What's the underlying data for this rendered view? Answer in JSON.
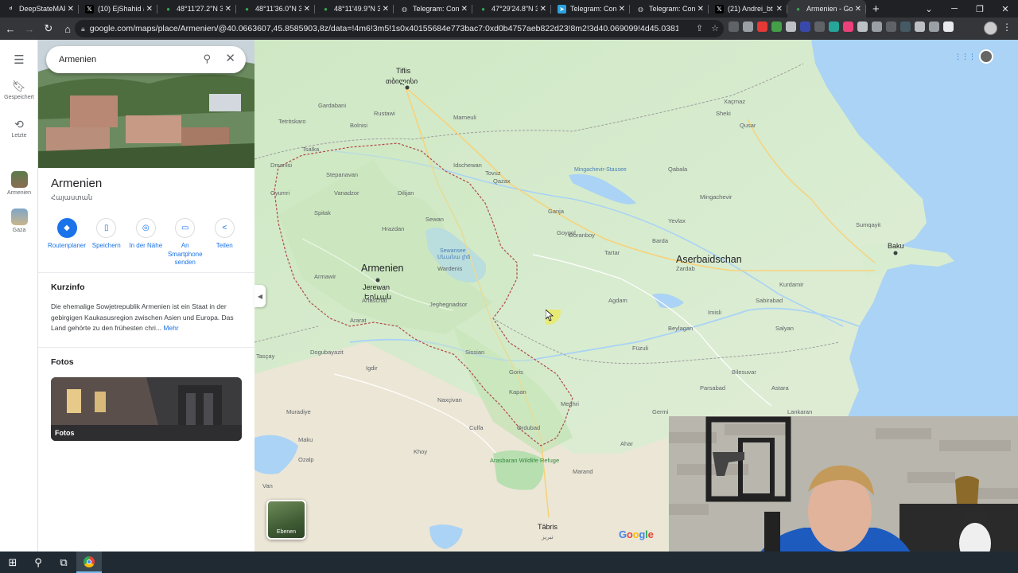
{
  "browser": {
    "tabs": [
      {
        "title": "DeepStateMAP",
        "favicon": "deepstate-icon",
        "active": false
      },
      {
        "title": "(10) EjShahid a",
        "favicon": "x-icon",
        "active": false
      },
      {
        "title": "48°11'27.2\"N 3",
        "favicon": "maps-pin-icon",
        "active": false
      },
      {
        "title": "48°11'36.0\"N 3",
        "favicon": "maps-pin-icon",
        "active": false
      },
      {
        "title": "48°11'49.9\"N 3",
        "favicon": "maps-pin-icon",
        "active": false
      },
      {
        "title": "Telegram: Cont",
        "favicon": "globe-icon",
        "active": false
      },
      {
        "title": "47°29'24.8\"N 3",
        "favicon": "maps-pin-icon",
        "active": false
      },
      {
        "title": "Telegram: Cont",
        "favicon": "telegram-icon",
        "active": false
      },
      {
        "title": "Telegram: Cont",
        "favicon": "globe-icon",
        "active": false
      },
      {
        "title": "(21) Andrei_bt",
        "favicon": "x-icon",
        "active": false
      },
      {
        "title": "Armenien - Go",
        "favicon": "maps-pin-icon",
        "active": true
      }
    ],
    "url": "google.com/maps/place/Armenien/@40.0663607,45.8585903,8z/data=!4m6!3m5!1s0x40155684e773bac7:0xd0b4757aeb822d23!8m2!3d40.069099!4d45.038189!16zL20vMGpneA?..."
  },
  "sidebar_rail": {
    "items": [
      {
        "label": "Gespeichert",
        "icon": "bookmark-icon"
      },
      {
        "label": "Letzte",
        "icon": "history-icon"
      },
      {
        "label": "Armenien",
        "icon": "armenia-thumb"
      },
      {
        "label": "Gaza",
        "icon": "gaza-thumb"
      }
    ]
  },
  "search": {
    "value": "Armenien"
  },
  "place": {
    "title": "Armenien",
    "subtitle": "Հայաստան",
    "actions": [
      {
        "label": "Routenplaner",
        "icon": "directions-icon"
      },
      {
        "label": "Speichern",
        "icon": "bookmark-icon"
      },
      {
        "label": "In der Nähe",
        "icon": "nearby-icon"
      },
      {
        "label": "An Smartphone senden",
        "icon": "phone-icon"
      },
      {
        "label": "Teilen",
        "icon": "share-icon"
      }
    ],
    "overview_heading": "Kurzinfo",
    "overview_text": "Die ehemalige Sowjetrepublik Armenien ist ein Staat in der gebirgigen Kaukasusregion zwischen Asien und Europa. Das Land gehörte zu den frühesten chri...",
    "overview_more": "Mehr",
    "photos_heading": "Fotos",
    "photos_label": "Fotos"
  },
  "map": {
    "countries": {
      "armenia": "Armenien",
      "azerbaijan": "Aserbaidschan"
    },
    "cities": {
      "tbilisi": "Tiflis",
      "tbilisi_local": "თბილისი",
      "yerevan": "Jerewan",
      "yerevan_local": "Երևան",
      "baku": "Baku",
      "tabriz": "Täbris",
      "tabriz_local": "تبریز",
      "ganja": "Ganja",
      "sumqayit": "Sumqayit",
      "van": "Van"
    },
    "places": [
      "Rustawi",
      "Gardabani",
      "Marneuli",
      "Bolnisi",
      "Tetritskaro",
      "Dmanisi",
      "Tsalka",
      "Stepanavan",
      "Vanadzor",
      "Dilijan",
      "Idschewan",
      "Gyumri",
      "Spitak",
      "Hrazdan",
      "Sewan",
      "Artaschat",
      "Ararat",
      "Armawir",
      "Wardenis",
      "Jeghegnadsor",
      "Sissian",
      "Goris",
      "Kapan",
      "Meghri",
      "Qazax",
      "Tovuz",
      "Goygol",
      "Goranboy",
      "Tartar",
      "Barda",
      "Agdam",
      "Füzuli",
      "Beylagan",
      "Imisli",
      "Sabirabad",
      "Salyan",
      "Kurdamir",
      "Zardab",
      "Yevlax",
      "Mingachevir",
      "Qabala",
      "Sheki",
      "Xaçmaz",
      "Qusar",
      "Dogubayazit",
      "Igdir",
      "Tasçay",
      "Muradiye",
      "Ozalp",
      "Khoy",
      "Maku",
      "Ordubad",
      "Culfa",
      "Naxçivan",
      "Parsabad",
      "Bilesuvar",
      "Germi",
      "Ahar",
      "Marand",
      "Astara",
      "Lankaran",
      "Ardabil"
    ],
    "water": [
      "Sewansee",
      "Սևանա լիճ",
      "Mingachevir-Stausee"
    ],
    "parks": [
      "Arasbaran Wildlife Refuge"
    ],
    "layers_label": "Ebenen",
    "logo": "Google",
    "apps_label": "Apps"
  },
  "taskbar": {
    "items": [
      "start-button",
      "search-button",
      "task-view-button",
      "chrome-app"
    ]
  }
}
